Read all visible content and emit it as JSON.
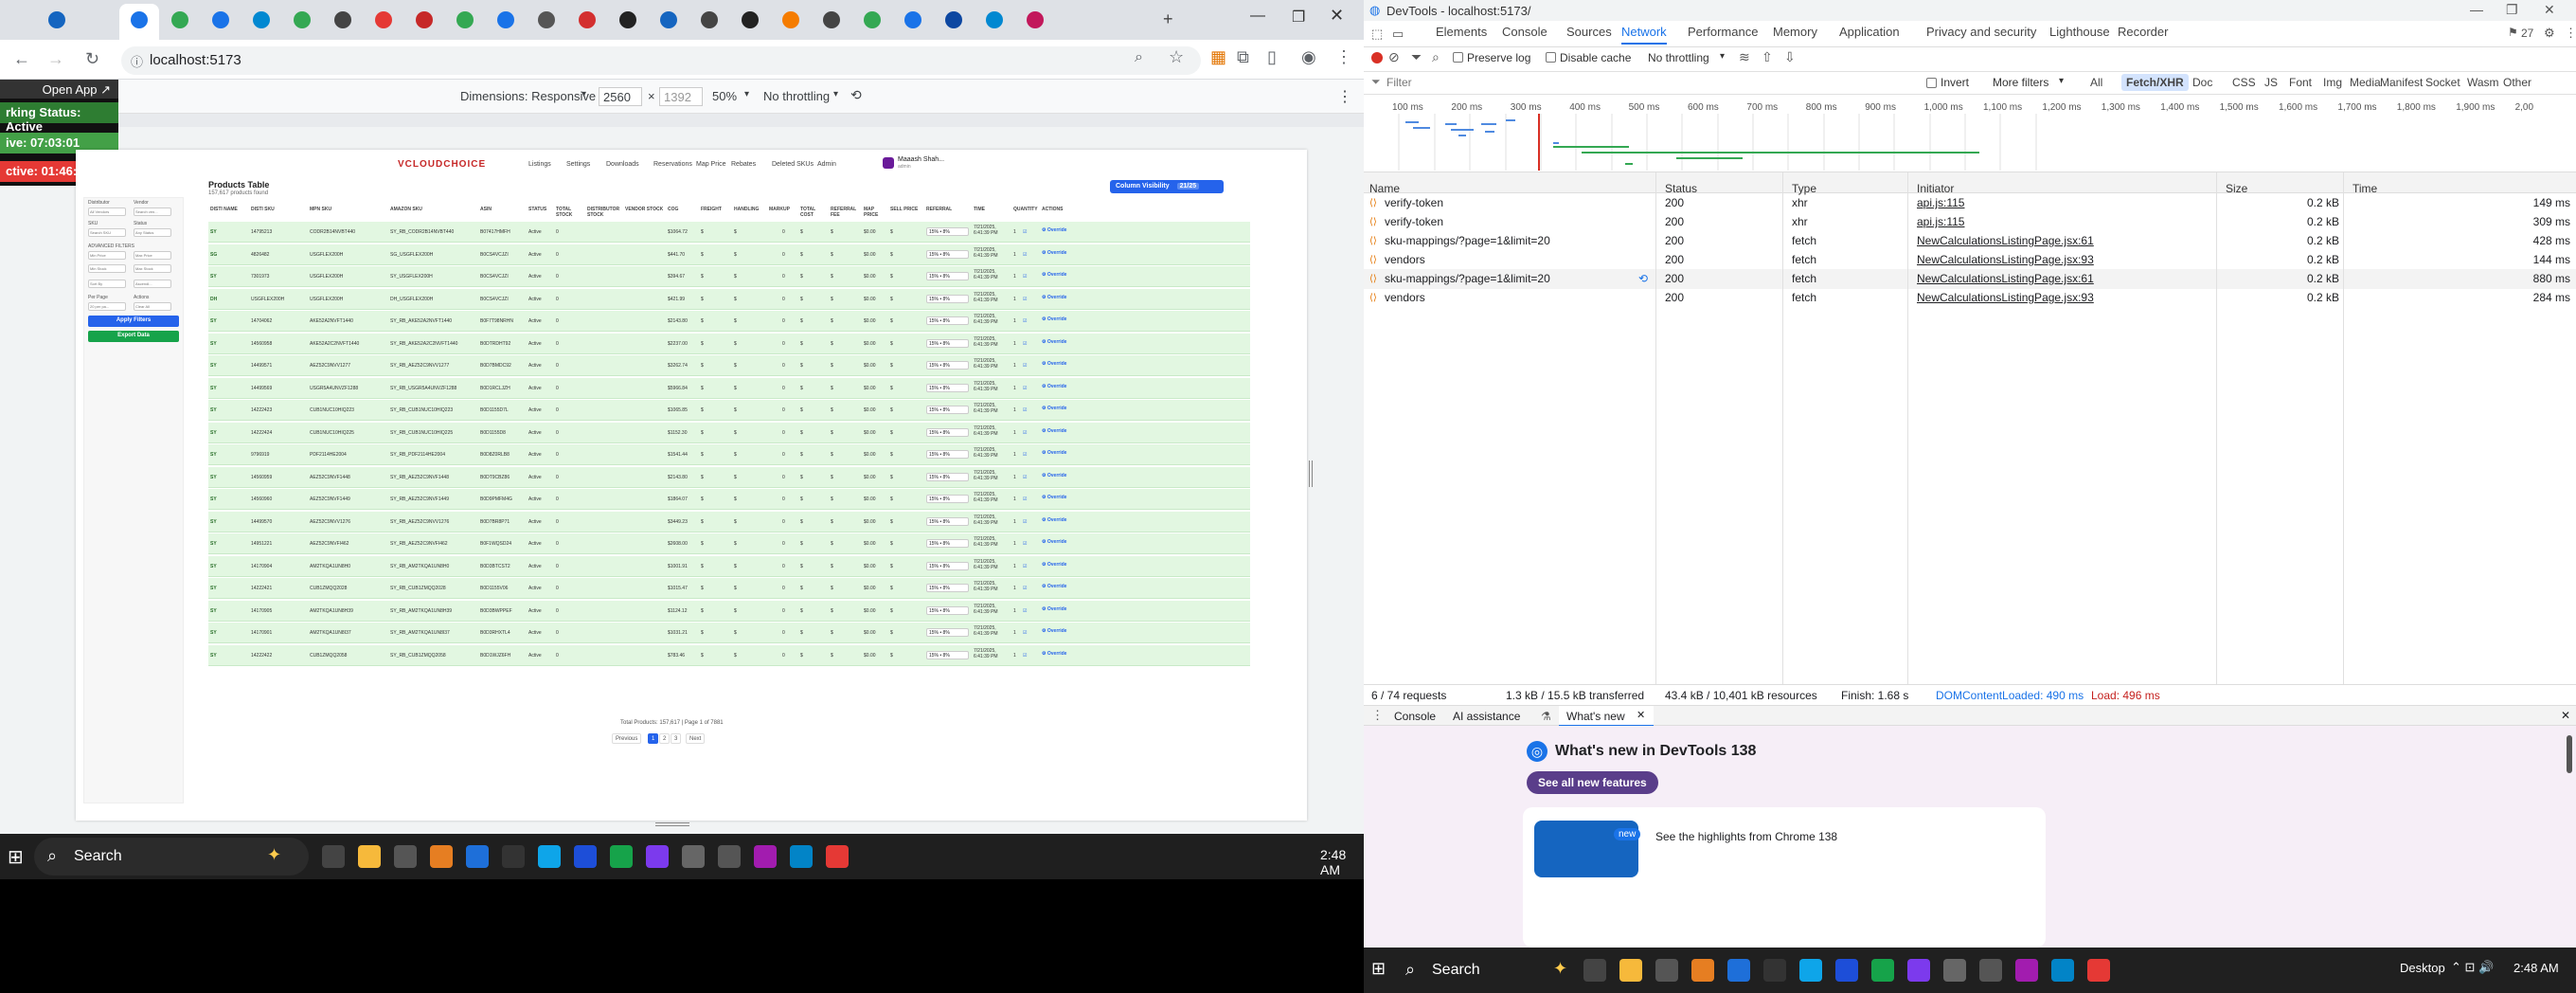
{
  "browser": {
    "url": "localhost:5173",
    "open_app_label": "Open App",
    "devtools_device": {
      "dimensions_label": "Dimensions: Responsive",
      "width": "2560",
      "times": "×",
      "height": "1392",
      "zoom": "50%",
      "throttle": "No throttling"
    },
    "floating_panel": {
      "status": "rking Status: Active",
      "live": "ive: 07:03:01",
      "inactive": "ctive: 01:46:14"
    }
  },
  "app": {
    "logo": "VCLOUDCHOICE",
    "nav": [
      "Listings",
      "Settings",
      "Downloads",
      "Reservations",
      "Map Price",
      "Rebates",
      "Deleted SKUs",
      "Admin"
    ],
    "user_name": "Maaash Shah...",
    "user_role": "admin",
    "heading": "Products Table",
    "subheading": "157,617 products found",
    "column_visibility": "Column Visibility",
    "column_visibility_count": "21/25",
    "filters": {
      "distributor_label": "Distributor",
      "vendor_label": "Vendor",
      "distributor_value": "All Vendors",
      "vendor_placeholder": "Search ven...",
      "sku_label": "SKU",
      "status_label": "Status",
      "sku_placeholder": "Search SKU",
      "status_value": "Any Status",
      "advanced_label": "ADVANCED FILTERS",
      "min_price": "Min Price",
      "max_price": "Max Price",
      "min_stock": "Min Stock",
      "max_stock": "Max Stock",
      "sort_by": "Sort By",
      "order": "Ascendi...",
      "per_page_label": "Per Page",
      "actions_label": "Actions",
      "per_page_value": "20 per pa...",
      "clear_all": "Clear All",
      "apply": "Apply Filters",
      "export": "Export Data"
    },
    "columns": [
      "DISTI NAME",
      "DISTI SKU",
      "MPN SKU",
      "AMAZON SKU",
      "ASIN",
      "STATUS",
      "TOTAL STOCK",
      "DISTRIBUTOR STOCK",
      "VENDOR STOCK",
      "COG",
      "FREIGHT",
      "HANDLING",
      "MARKUP",
      "TOTAL COST",
      "REFERRAL FEE",
      "MAP PRICE",
      "SELL PRICE",
      "REFERRAL",
      "TIME",
      "QUANTITY",
      "ACTIONS"
    ],
    "rows": [
      {
        "disti": "SY",
        "sku": "14795213",
        "mpn": "CODR2B14NVBT440",
        "amz": "SY_RB_CODR2B14NVBT440",
        "asin": "B07417HMFH",
        "cog": "$1064.72",
        "time": "7/21/2025, 6:41:39 PM"
      },
      {
        "disti": "SG",
        "sku": "4826482",
        "mpn": "USGFLEX200H",
        "amz": "SG_USGFLEX200H",
        "asin": "B0CS4VCJZI",
        "cog": "$441.70",
        "time": "7/21/2025, 6:41:39 PM"
      },
      {
        "disti": "SY",
        "sku": "7301973",
        "mpn": "USGFLEX200H",
        "amz": "SY_USGFLEX200H",
        "asin": "B0CS4VCJZI",
        "cog": "$394.67",
        "time": "7/21/2025, 6:41:39 PM"
      },
      {
        "disti": "DH",
        "sku": "USGFLEX200H",
        "mpn": "USGFLEX200H",
        "amz": "DH_USGFLEX200H",
        "asin": "B0CS4VCJZI",
        "cog": "$421.99",
        "time": "7/21/2025, 6:41:39 PM"
      },
      {
        "disti": "SY",
        "sku": "14704062",
        "mpn": "AKE52A2NVFT1440",
        "amz": "SY_RB_AKE52A2NVFT1440",
        "asin": "B0F7T98NRHN",
        "cog": "$2143.80",
        "time": "7/21/2025, 6:41:39 PM"
      },
      {
        "disti": "SY",
        "sku": "14560958",
        "mpn": "AKE52A2C2NVFT1440",
        "amz": "SY_RB_AKE52A2C2NVFT1440",
        "asin": "B0DTRDHT92",
        "cog": "$2237.00",
        "time": "7/21/2025, 6:41:39 PM"
      },
      {
        "disti": "SY",
        "sku": "14499571",
        "mpn": "AEZ52C9NVV1277",
        "amz": "SY_RB_AEZ52C9NVV1277",
        "asin": "B0D7BMDC92",
        "cog": "$3262.74",
        "time": "7/21/2025, 6:41:39 PM"
      },
      {
        "disti": "SY",
        "sku": "14499569",
        "mpn": "USGR5A4UNVZF1288",
        "amz": "SY_RB_USGR5A4UNVZF1288",
        "asin": "B0D1RCLJZH",
        "cog": "$5966.84",
        "time": "7/21/2025, 6:41:39 PM"
      },
      {
        "disti": "SY",
        "sku": "14222423",
        "mpn": "CUB1NUC10HIQ223",
        "amz": "SY_RB_CUB1NUC10HIQ223",
        "asin": "B0D1155D7L",
        "cog": "$1065.85",
        "time": "7/21/2025, 6:41:39 PM"
      },
      {
        "disti": "SY",
        "sku": "14222424",
        "mpn": "CUB1NUC10HIQ225",
        "amz": "SY_RB_CUB1NUC10HIQ225",
        "asin": "B0D1155D8",
        "cog": "$1152.30",
        "time": "7/21/2025, 6:41:39 PM"
      },
      {
        "disti": "SY",
        "sku": "9796919",
        "mpn": "PDF2114HE2004",
        "amz": "SY_RB_PDF2114HE2004",
        "asin": "B0D8Z0RLB8",
        "cog": "$1541.44",
        "time": "7/21/2025, 6:41:39 PM"
      },
      {
        "disti": "SY",
        "sku": "14560959",
        "mpn": "AEZ52C9NVF1448",
        "amz": "SY_RB_AEZ52C9NVF1448",
        "asin": "B0DT9CBZ86",
        "cog": "$2143.80",
        "time": "7/21/2025, 6:41:39 PM"
      },
      {
        "disti": "SY",
        "sku": "14560960",
        "mpn": "AEZ52C9NVF1449",
        "amz": "SY_RB_AEZ52C9NVF1449",
        "asin": "B0D9PMFM4G",
        "cog": "$1864.07",
        "time": "7/21/2025, 6:41:39 PM"
      },
      {
        "disti": "SY",
        "sku": "14499570",
        "mpn": "AEZ52C9NVV1276",
        "amz": "SY_RB_AEZ52C9NVV1276",
        "asin": "B0D7BR8P71",
        "cog": "$3449.23",
        "time": "7/21/2025, 6:41:39 PM"
      },
      {
        "disti": "SY",
        "sku": "14951221",
        "mpn": "AEZ52C9NVFI462",
        "amz": "SY_RB_AEZ52C9NVFI462",
        "asin": "B0F1WQSD24",
        "cog": "$2608.00",
        "time": "7/21/2025, 6:41:39 PM"
      },
      {
        "disti": "SY",
        "sku": "14170904",
        "mpn": "AM2TKQA1UN8H0",
        "amz": "SY_RB_AM2TKQA1UN8H0",
        "asin": "B0D3BTCST2",
        "cog": "$1001.91",
        "time": "7/21/2025, 6:41:39 PM"
      },
      {
        "disti": "SY",
        "sku": "14222421",
        "mpn": "CUB1ZMQQ2028",
        "amz": "SY_RB_CUB1ZMQQ2028",
        "asin": "B0D1155V06",
        "cog": "$1015.47",
        "time": "7/21/2025, 6:41:39 PM"
      },
      {
        "disti": "SY",
        "sku": "14170905",
        "mpn": "AM2TKQA1UN8H39",
        "amz": "SY_RB_AM2TKQA1UN8H39",
        "asin": "B0D3BWPPEF",
        "cog": "$1124.12",
        "time": "7/21/2025, 6:41:39 PM"
      },
      {
        "disti": "SY",
        "sku": "14170901",
        "mpn": "AM2TKQA1UN8I37",
        "amz": "SY_RB_AM2TKQA1UN8I37",
        "asin": "B0D3RHXTL4",
        "cog": "$1031.21",
        "time": "7/21/2025, 6:41:39 PM"
      },
      {
        "disti": "SY",
        "sku": "14222422",
        "mpn": "CUB1ZMQQ2058",
        "amz": "SY_RB_CUB1ZMQQ2058",
        "asin": "B0D1WJZ6FH",
        "cog": "$783.46",
        "time": "7/21/2025, 6:41:39 PM"
      }
    ],
    "common": {
      "status": "Active",
      "stock": "0",
      "zero": "$0.00",
      "dollar": "$",
      "referral": "15% • 8%",
      "qty": "1",
      "override": "Override"
    },
    "pagination": {
      "summary": "Total Products: 157,617 | Page 1 of 7881",
      "previous": "Previous",
      "pages": [
        "1",
        "2",
        "3"
      ],
      "next": "Next"
    }
  },
  "taskbar": {
    "search": "Search",
    "time": "2:48 AM"
  },
  "devtools": {
    "title": "DevTools - localhost:5173/",
    "tab_count": "27",
    "tabs": [
      "Elements",
      "Console",
      "Sources",
      "Network",
      "Performance",
      "Memory",
      "Application",
      "Privacy and security",
      "Lighthouse",
      "Recorder"
    ],
    "active_tab": "Network",
    "preserve_log": "Preserve log",
    "disable_cache": "Disable cache",
    "throttling": "No throttling",
    "filter_placeholder": "Filter",
    "invert": "Invert",
    "more_filters": "More filters",
    "filter_types": [
      "All",
      "Fetch/XHR",
      "Doc",
      "CSS",
      "JS",
      "Font",
      "Img",
      "Media",
      "Manifest",
      "Socket",
      "Wasm",
      "Other"
    ],
    "timeline_ticks": [
      "100 ms",
      "200 ms",
      "300 ms",
      "400 ms",
      "500 ms",
      "600 ms",
      "700 ms",
      "800 ms",
      "900 ms",
      "1,000 ms",
      "1,100 ms",
      "1,200 ms",
      "1,300 ms",
      "1,400 ms",
      "1,500 ms",
      "1,600 ms",
      "1,700 ms",
      "1,800 ms",
      "1,900 ms",
      "2,00"
    ],
    "columns": [
      "Name",
      "Status",
      "Type",
      "Initiator",
      "Size",
      "Time"
    ],
    "requests": [
      {
        "name": "verify-token",
        "status": "200",
        "type": "xhr",
        "initiator": "api.js:115",
        "size": "0.2 kB",
        "time": "149 ms"
      },
      {
        "name": "verify-token",
        "status": "200",
        "type": "xhr",
        "initiator": "api.js:115",
        "size": "0.2 kB",
        "time": "309 ms"
      },
      {
        "name": "sku-mappings/?page=1&limit=20",
        "status": "200",
        "type": "fetch",
        "initiator": "NewCalculationsListingPage.jsx:61",
        "size": "0.2 kB",
        "time": "428 ms"
      },
      {
        "name": "vendors",
        "status": "200",
        "type": "fetch",
        "initiator": "NewCalculationsListingPage.jsx:93",
        "size": "0.2 kB",
        "time": "144 ms"
      },
      {
        "name": "sku-mappings/?page=1&limit=20",
        "status": "200",
        "type": "fetch",
        "initiator": "NewCalculationsListingPage.jsx:61",
        "size": "0.2 kB",
        "time": "880 ms"
      },
      {
        "name": "vendors",
        "status": "200",
        "type": "fetch",
        "initiator": "NewCalculationsListingPage.jsx:93",
        "size": "0.2 kB",
        "time": "284 ms"
      }
    ],
    "summary": {
      "requests": "6 / 74 requests",
      "transferred": "1.3 kB / 15.5 kB transferred",
      "resources": "43.4 kB / 10,401 kB resources",
      "finish": "Finish: 1.68 s",
      "dcl": "DOMContentLoaded: 490 ms",
      "load": "Load: 496 ms"
    },
    "drawer_tabs": [
      "Console",
      "AI assistance",
      "What's new"
    ],
    "whatsnew_title": "What's new in DevTools 138",
    "whatsnew_button": "See all new features",
    "whatsnew_badge": "new",
    "whatsnew_highlight": "See the highlights from Chrome 138",
    "taskbar_search": "Search",
    "taskbar_desktop": "Desktop",
    "taskbar_time": "2:48 AM"
  }
}
